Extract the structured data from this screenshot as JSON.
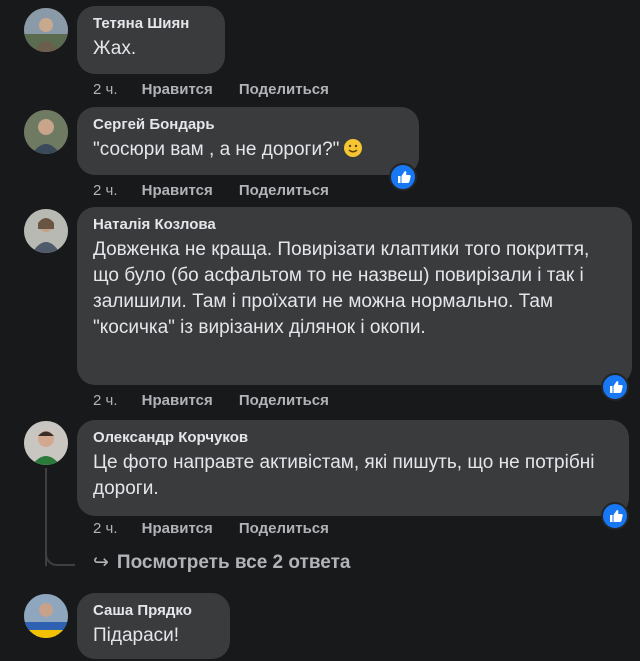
{
  "comments": [
    {
      "author": "Тетяна Шиян",
      "text": "Жах.",
      "time": "2 ч.",
      "like": "Нравится",
      "reply": "Поделиться"
    },
    {
      "author": "Сергей Бондарь",
      "text": "\"сосюри вам , а не дороги?\"",
      "time": "2 ч.",
      "like": "Нравится",
      "reply": "Поделиться",
      "emoji": "slightly-smiling-face-icon"
    },
    {
      "author": "Наталія Козлова",
      "text": "Довженка не краща. Повирізати клаптики того покриття, що було (бо асфальтом то не назвеш) повирізали і так і залишили. Там і проїхати не можна нормально. Там \"косичка\" із вирізаних ділянок і окопи.",
      "time": "2 ч.",
      "like": "Нравится",
      "reply": "Поделиться"
    },
    {
      "author": "Олександр Корчуков",
      "text": "Це фото направте активістам, які пишуть, що не потрібні дороги.",
      "time": "2 ч.",
      "like": "Нравится",
      "reply": "Поделиться"
    },
    {
      "author": "Саша Прядко",
      "text": "Підараси!"
    }
  ],
  "view_replies": {
    "label": "Посмотреть все 2 ответа"
  },
  "colors": {
    "background": "#18191a",
    "bubble": "#3a3b3c",
    "like_badge": "#1877f2",
    "meta_text": "#b0b3b8"
  }
}
